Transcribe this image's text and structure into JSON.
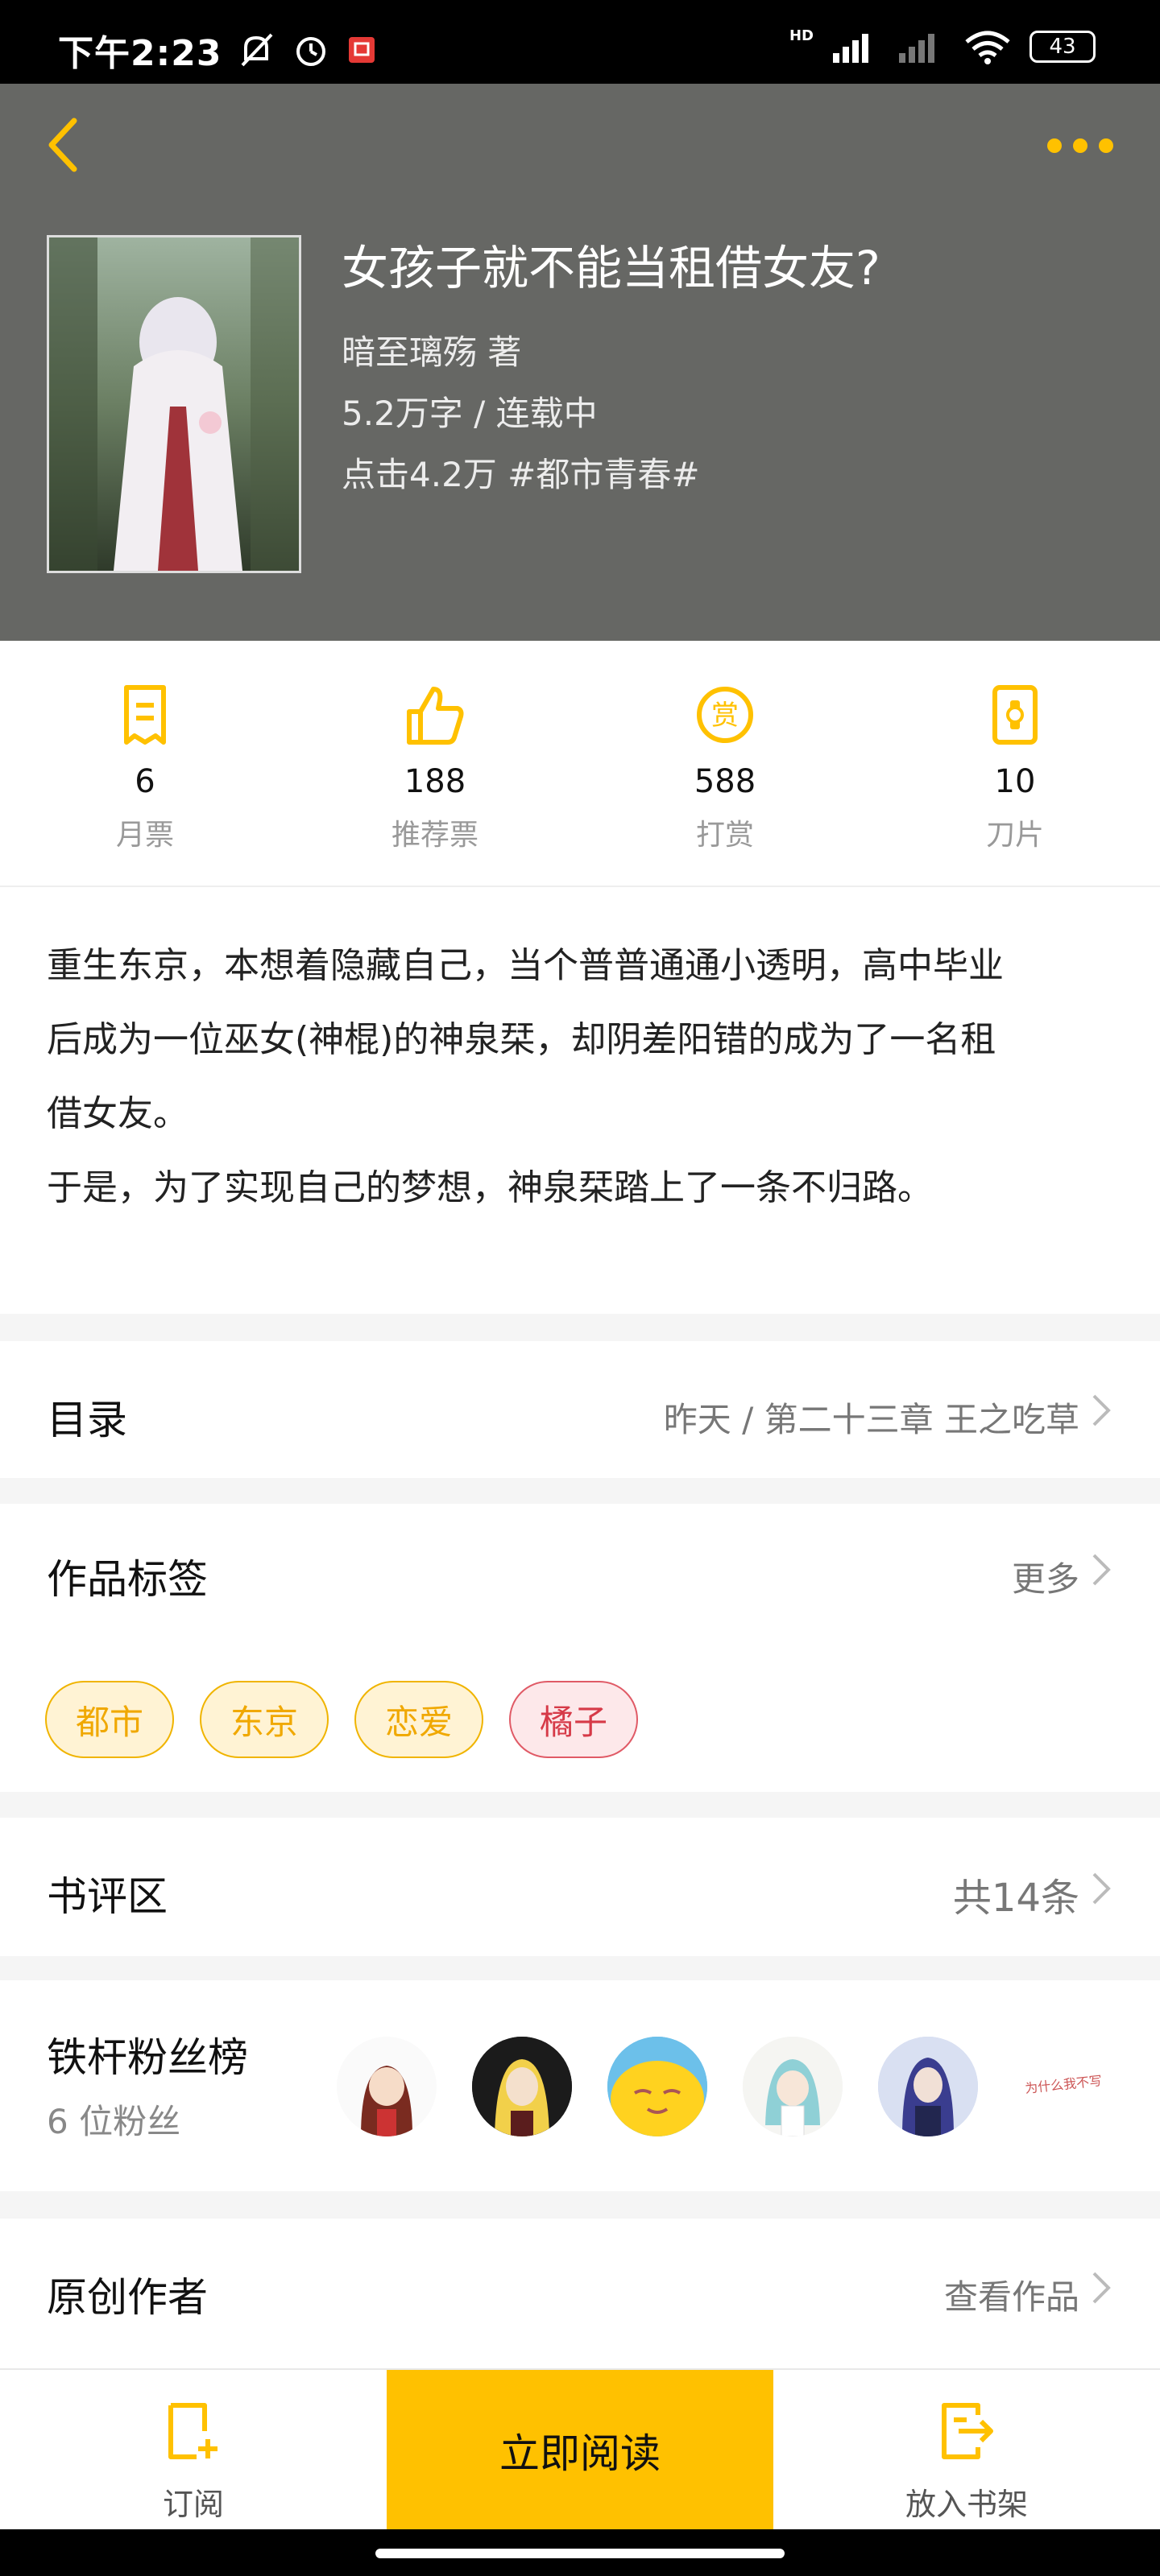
{
  "status_bar": {
    "time": "下午2:23",
    "battery": "43",
    "network_label": "HD"
  },
  "book": {
    "title": "女孩子就不能当租借女友?",
    "author_line": "暗至璃殇  著",
    "words_status": "5.2万字 / 连载中",
    "clicks_genre": "点击4.2万  #都市青春#"
  },
  "stats": [
    {
      "value": "6",
      "label": "月票",
      "icon": "ticket-icon"
    },
    {
      "value": "188",
      "label": "推荐票",
      "icon": "thumbs-up-icon"
    },
    {
      "value": "588",
      "label": "打赏",
      "icon": "reward-coin-icon"
    },
    {
      "value": "10",
      "label": "刀片",
      "icon": "blade-icon"
    }
  ],
  "synopsis": {
    "line1": "重生东京，本想着隐藏自己，当个普普通通小透明，高中毕业",
    "line2": "后成为一位巫女(神棍)的神泉栞，却阴差阳错的成为了一名租",
    "line3": "借女友。",
    "line4": "于是，为了实现自己的梦想，神泉栞踏上了一条不归路。"
  },
  "catalog": {
    "title": "目录",
    "latest": "昨天 / 第二十三章 王之吃草"
  },
  "tags_section": {
    "title": "作品标签",
    "more": "更多",
    "tags": [
      "都市",
      "东京",
      "恋爱",
      "橘子"
    ]
  },
  "reviews": {
    "title": "书评区",
    "count": "共14条"
  },
  "fans": {
    "title": "铁杆粉丝榜",
    "count": "6 位粉丝",
    "last_avatar_text": "为什么我不写"
  },
  "author_section": {
    "title": "原创作者",
    "link": "查看作品"
  },
  "bottom_bar": {
    "subscribe": "订阅",
    "read_now": "立即阅读",
    "add_shelf": "放入书架"
  },
  "colors": {
    "accent": "#ffc100",
    "hero_bg": "#666764",
    "tag_yellow": "#f0a800",
    "tag_red": "#d63a48"
  }
}
